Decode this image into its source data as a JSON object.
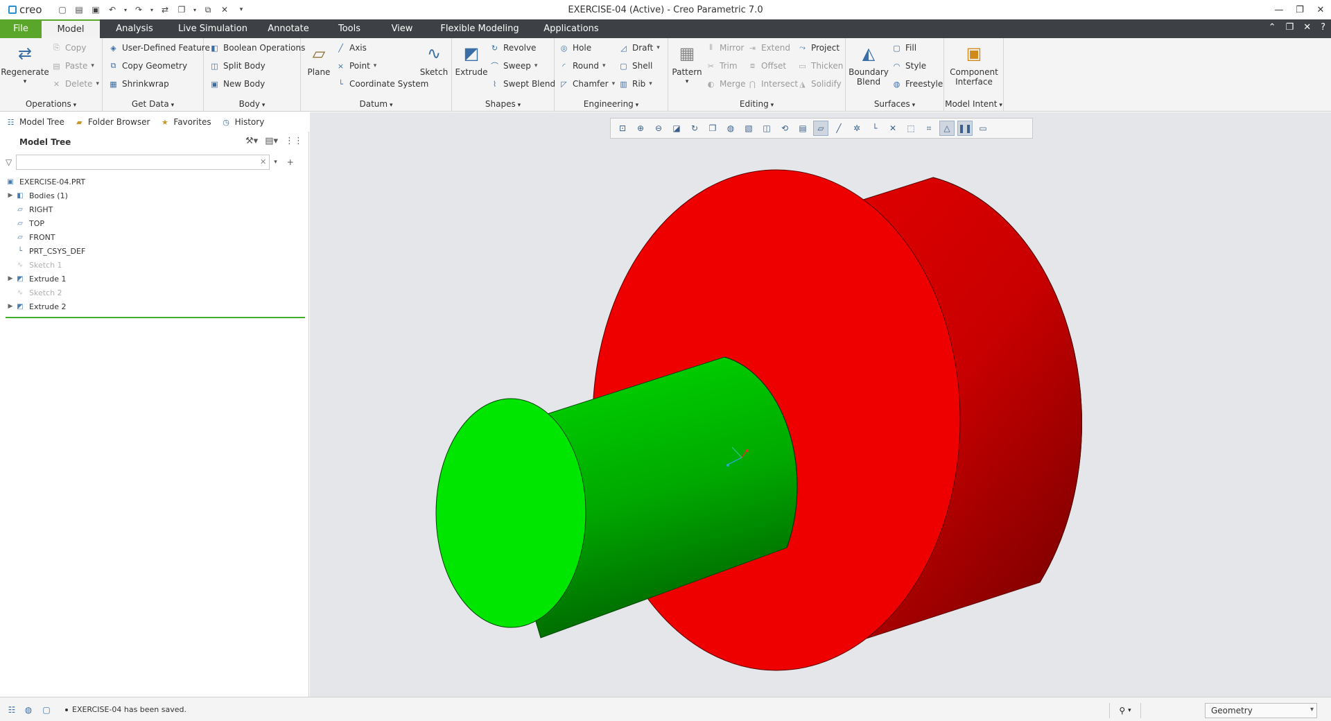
{
  "window": {
    "app_logo": "creo",
    "title": "EXERCISE-04 (Active) - Creo Parametric 7.0",
    "controls": [
      "minimize-icon",
      "restore-icon",
      "close-icon"
    ]
  },
  "menu": {
    "file": "File",
    "tabs": [
      "Model",
      "Analysis",
      "Live Simulation",
      "Annotate",
      "Tools",
      "View",
      "Flexible Modeling",
      "Applications"
    ],
    "active_tab": "Model",
    "right_icons": [
      "collapse-ribbon-icon",
      "restore-icon",
      "close-icon",
      "help-icon"
    ]
  },
  "ribbon": {
    "operations": {
      "label": "Operations",
      "regenerate": "Regenerate",
      "copy": "Copy",
      "paste": "Paste",
      "delete": "Delete"
    },
    "get_data": {
      "label": "Get Data",
      "udf": "User-Defined Feature",
      "copy_geometry": "Copy Geometry",
      "shrinkwrap": "Shrinkwrap"
    },
    "body": {
      "label": "Body",
      "boolean": "Boolean Operations",
      "split": "Split Body",
      "new": "New Body"
    },
    "datum": {
      "label": "Datum",
      "plane": "Plane",
      "axis": "Axis",
      "point": "Point",
      "csys": "Coordinate System",
      "sketch": "Sketch"
    },
    "shapes": {
      "label": "Shapes",
      "extrude": "Extrude",
      "revolve": "Revolve",
      "sweep": "Sweep",
      "swept_blend": "Swept Blend"
    },
    "engineering": {
      "label": "Engineering",
      "hole": "Hole",
      "round": "Round",
      "chamfer": "Chamfer",
      "draft": "Draft",
      "shell": "Shell",
      "rib": "Rib"
    },
    "editing": {
      "label": "Editing",
      "pattern": "Pattern",
      "mirror": "Mirror",
      "trim": "Trim",
      "merge": "Merge",
      "extend": "Extend",
      "offset": "Offset",
      "intersect": "Intersect",
      "project": "Project",
      "thicken": "Thicken",
      "solidify": "Solidify"
    },
    "surfaces": {
      "label": "Surfaces",
      "boundary_blend": "Boundary Blend",
      "fill": "Fill",
      "style": "Style",
      "freestyle": "Freestyle"
    },
    "model_intent": {
      "label": "Model Intent",
      "component_interface": "Component Interface"
    }
  },
  "nav_tabs": [
    "Model Tree",
    "Folder Browser",
    "Favorites",
    "History"
  ],
  "model_tree": {
    "title": "Model Tree",
    "search_value": "",
    "items": [
      {
        "label": "EXERCISE-04.PRT",
        "icon": "part-icon",
        "expandable": false,
        "suppressed": false,
        "indent": 0
      },
      {
        "label": "Bodies (1)",
        "icon": "bodies-icon",
        "expandable": true,
        "suppressed": false,
        "indent": 1
      },
      {
        "label": "RIGHT",
        "icon": "datum-plane-icon",
        "expandable": false,
        "suppressed": false,
        "indent": 1
      },
      {
        "label": "TOP",
        "icon": "datum-plane-icon",
        "expandable": false,
        "suppressed": false,
        "indent": 1
      },
      {
        "label": "FRONT",
        "icon": "datum-plane-icon",
        "expandable": false,
        "suppressed": false,
        "indent": 1
      },
      {
        "label": "PRT_CSYS_DEF",
        "icon": "csys-icon",
        "expandable": false,
        "suppressed": false,
        "indent": 1
      },
      {
        "label": "Sketch 1",
        "icon": "sketch-icon",
        "expandable": false,
        "suppressed": true,
        "indent": 1
      },
      {
        "label": "Extrude 1",
        "icon": "extrude-icon",
        "expandable": true,
        "suppressed": false,
        "indent": 1
      },
      {
        "label": "Sketch 2",
        "icon": "sketch-icon",
        "expandable": false,
        "suppressed": true,
        "indent": 1
      },
      {
        "label": "Extrude 2",
        "icon": "extrude-icon",
        "expandable": true,
        "suppressed": false,
        "indent": 1
      }
    ]
  },
  "graphics_toolbar": [
    "refit-icon",
    "zoom-in-icon",
    "zoom-out-icon",
    "repaint-icon",
    "reorient-icon",
    "saved-views-icon",
    "display-style-icon",
    "perspective-icon",
    "section-icon",
    "datum-display-icon",
    "annotation-display-icon",
    "plane-display-icon",
    "axis-display-icon",
    "point-display-icon",
    "csys-display-icon",
    "spin-center-icon",
    "hidden-line-icon",
    "edge-display-icon",
    "shading-icon",
    "pause-icon",
    "render-icon"
  ],
  "model_colors": {
    "small_cylinder": "#00e600",
    "large_cylinder": "#ef0000",
    "background": "#e4e6e9"
  },
  "status": {
    "message": "EXERCISE-04 has been saved.",
    "filter_value": "Geometry"
  }
}
